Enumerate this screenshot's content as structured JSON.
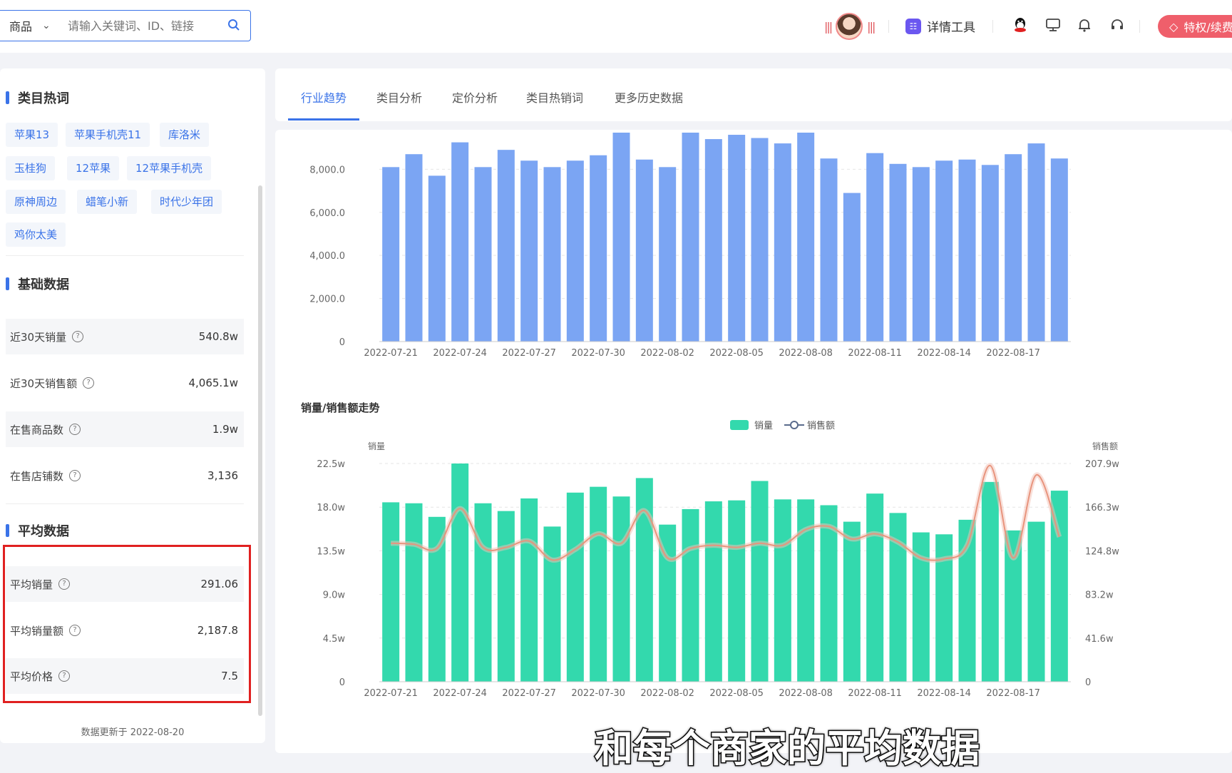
{
  "topbar": {
    "search_category": "商品",
    "search_placeholder": "请输入关键词、ID、链接",
    "tool_label": "详情工具",
    "vip_label": "特权/续费"
  },
  "left": {
    "hotwords_title": "类目热词",
    "hotwords": [
      "苹果13",
      "苹果手机壳11",
      "库洛米",
      "玉桂狗",
      "12苹果",
      "12苹果手机壳",
      "原神周边",
      "蜡笔小新",
      "时代少年团",
      "鸡你太美"
    ],
    "basic_title": "基础数据",
    "basic": [
      {
        "label": "近30天销量",
        "value": "540.8w"
      },
      {
        "label": "近30天销售额",
        "value": "4,065.1w"
      },
      {
        "label": "在售商品数",
        "value": "1.9w"
      },
      {
        "label": "在售店铺数",
        "value": "3,136"
      }
    ],
    "avg_title": "平均数据",
    "avg": [
      {
        "label": "平均销量",
        "value": "291.06"
      },
      {
        "label": "平均销量额",
        "value": "2,187.8"
      },
      {
        "label": "平均价格",
        "value": "7.5"
      }
    ],
    "updated": "数据更新于 2022-08-20"
  },
  "tabs": [
    "行业趋势",
    "类目分析",
    "定价分析",
    "类目热销词",
    "更多历史数据"
  ],
  "subtitle": "和每个商家的平均数据",
  "chart_data": [
    {
      "type": "bar",
      "title": "",
      "categories": [
        "2022-07-21",
        "2022-07-22",
        "2022-07-23",
        "2022-07-24",
        "2022-07-25",
        "2022-07-26",
        "2022-07-27",
        "2022-07-28",
        "2022-07-29",
        "2022-07-30",
        "2022-07-31",
        "2022-08-01",
        "2022-08-02",
        "2022-08-03",
        "2022-08-04",
        "2022-08-05",
        "2022-08-06",
        "2022-08-07",
        "2022-08-08",
        "2022-08-09",
        "2022-08-10",
        "2022-08-11",
        "2022-08-12",
        "2022-08-13",
        "2022-08-14",
        "2022-08-15",
        "2022-08-16",
        "2022-08-17",
        "2022-08-18",
        "2022-08-19"
      ],
      "x_tick_labels": [
        "2022-07-21",
        "2022-07-24",
        "2022-07-27",
        "2022-07-30",
        "2022-08-02",
        "2022-08-05",
        "2022-08-08",
        "2022-08-11",
        "2022-08-14",
        "2022-08-17"
      ],
      "values": [
        8100,
        8700,
        7700,
        9250,
        8100,
        8900,
        8400,
        8100,
        8400,
        8650,
        9700,
        8450,
        8100,
        9700,
        9400,
        9600,
        9450,
        9200,
        9700,
        8500,
        6900,
        8750,
        8250,
        8100,
        8400,
        8450,
        8200,
        8700,
        9200,
        8500
      ],
      "ylim": [
        0,
        9700
      ],
      "y_ticks": [
        "0",
        "2,000.0",
        "4,000.0",
        "6,000.0",
        "8,000.0"
      ],
      "color": "#7ba5f3"
    },
    {
      "type": "bar",
      "title": "销量/销售额走势",
      "legend": [
        "销量",
        "销售额"
      ],
      "categories": [
        "2022-07-21",
        "2022-07-22",
        "2022-07-23",
        "2022-07-24",
        "2022-07-25",
        "2022-07-26",
        "2022-07-27",
        "2022-07-28",
        "2022-07-29",
        "2022-07-30",
        "2022-07-31",
        "2022-08-01",
        "2022-08-02",
        "2022-08-03",
        "2022-08-04",
        "2022-08-05",
        "2022-08-06",
        "2022-08-07",
        "2022-08-08",
        "2022-08-09",
        "2022-08-10",
        "2022-08-11",
        "2022-08-12",
        "2022-08-13",
        "2022-08-14",
        "2022-08-15",
        "2022-08-16",
        "2022-08-17",
        "2022-08-18",
        "2022-08-19"
      ],
      "x_tick_labels": [
        "2022-07-21",
        "2022-07-24",
        "2022-07-27",
        "2022-07-30",
        "2022-08-02",
        "2022-08-05",
        "2022-08-08",
        "2022-08-11",
        "2022-08-14",
        "2022-08-17"
      ],
      "ylabel": "销量",
      "y2label": "销售额",
      "ylim": [
        0,
        22.5
      ],
      "y2lim": [
        0,
        207.9
      ],
      "y_ticks": [
        "0",
        "4.5w",
        "9.0w",
        "13.5w",
        "18.0w",
        "22.5w"
      ],
      "y2_ticks": [
        "0",
        "41.6w",
        "83.2w",
        "124.8w",
        "166.3w",
        "207.9w"
      ],
      "series": [
        {
          "name": "销量",
          "type": "bar",
          "color": "#33d9ad",
          "values": [
            18.5,
            18.4,
            17.0,
            22.5,
            18.4,
            17.6,
            18.9,
            16.0,
            19.5,
            20.1,
            19.1,
            21.0,
            16.2,
            17.8,
            18.6,
            18.7,
            20.7,
            18.8,
            18.8,
            18.2,
            16.5,
            19.4,
            17.4,
            15.4,
            15.2,
            16.7,
            20.6,
            15.6,
            16.5,
            19.7
          ]
        },
        {
          "name": "销售额",
          "type": "line",
          "color": "#e8947d",
          "values": [
            132,
            131,
            127,
            165,
            128,
            128,
            134,
            116,
            126,
            141,
            132,
            163,
            118,
            127,
            130,
            128,
            132,
            130,
            145,
            148,
            136,
            141,
            133,
            118,
            117,
            130,
            206,
            118,
            197,
            138
          ]
        }
      ]
    }
  ]
}
